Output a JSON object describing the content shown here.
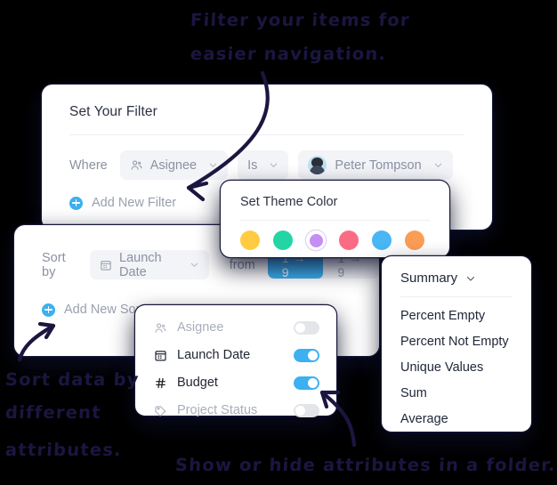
{
  "annotations": {
    "top_line1": "Filter your items for",
    "top_line2": "easier navigation.",
    "left_line1": "Sort data by",
    "left_line2": "different",
    "left_line3": "attributes.",
    "bottom": "Show or hide attributes in a folder."
  },
  "filter_card": {
    "title": "Set Your Filter",
    "where_label": "Where",
    "field_chip": {
      "icon": "people-icon",
      "label": "Asignee",
      "chevron": "chevron-down-icon"
    },
    "operator_chip": {
      "label": "Is",
      "chevron": "chevron-down-icon"
    },
    "value_chip": {
      "avatar": "user-avatar",
      "label": "Peter Tompson",
      "chevron": "chevron-down-icon"
    },
    "add_new": {
      "icon": "plus-circle-icon",
      "label": "Add New Filter"
    }
  },
  "sort_card": {
    "sort_by_label": "Sort by",
    "field_chip": {
      "icon": "calendar-icon",
      "label": "Launch Date",
      "chevron": "chevron-down-icon"
    },
    "from_label": "from",
    "direction_options": [
      {
        "label": "1 → 9",
        "active": true
      },
      {
        "label": "1 → 9",
        "active": false
      }
    ],
    "add_new": {
      "icon": "plus-circle-icon",
      "label": "Add New Sort"
    }
  },
  "theme_panel": {
    "title": "Set Theme Color",
    "swatches": [
      {
        "name": "yellow",
        "color": "#ffcc41",
        "selected": false
      },
      {
        "name": "green",
        "color": "#23d5a4",
        "selected": false
      },
      {
        "name": "purple",
        "color": "#c48ef5",
        "selected": true
      },
      {
        "name": "pink",
        "color": "#fb6b83",
        "selected": false
      },
      {
        "name": "blue",
        "color": "#49b6f5",
        "selected": false
      },
      {
        "name": "orange",
        "color": "#fb9d55",
        "selected": false
      }
    ]
  },
  "attributes_panel": {
    "items": [
      {
        "icon": "people-icon",
        "label": "Asignee",
        "enabled": false
      },
      {
        "icon": "calendar-icon",
        "label": "Launch Date",
        "enabled": true
      },
      {
        "icon": "hash-icon",
        "label": "Budget",
        "enabled": true
      },
      {
        "icon": "tag-icon",
        "label": "Project Status",
        "enabled": false
      }
    ]
  },
  "summary_panel": {
    "title": "Summary",
    "chevron": "chevron-down-icon",
    "items": [
      "Percent Empty",
      "Percent Not Empty",
      "Unique Values",
      "Sum",
      "Average"
    ]
  },
  "colors": {
    "accent_blue": "#3cb0f0",
    "ink": "#1b1640",
    "background": "#000000"
  }
}
